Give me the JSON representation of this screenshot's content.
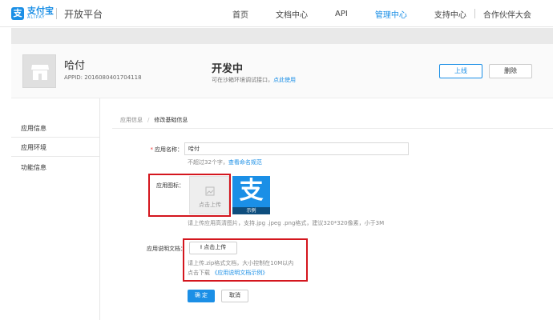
{
  "nav": {
    "logo_cn": "支付宝",
    "logo_en": "ALIPAY",
    "platform": "开放平台",
    "links": [
      "首页",
      "文档中心",
      "API",
      "管理中心",
      "支持中心",
      "合作伙伴大会"
    ],
    "active_index": 3
  },
  "app": {
    "name": "哈付",
    "appid": "APPID: 2016080401704118",
    "status_title": "开发中",
    "status_desc": "可在沙箱环境调试接口，",
    "status_link": "点此使用",
    "online_label": "上线",
    "delete_label": "删除"
  },
  "sidebar": {
    "items": [
      "应用信息",
      "应用环境",
      "功能信息"
    ]
  },
  "breadcrumb": {
    "parent": "应用信息",
    "current": "修改基础信息"
  },
  "form": {
    "name_label": "应用名称：",
    "name_value": "哈付",
    "name_hint": "不超过32个字，",
    "name_hint_link": "查看命名规范",
    "icon_label": "应用图标：",
    "upload_label": "点击上传",
    "sample_label": "示例",
    "icon_hint": "请上传应用高清图片，支持.jpg .jpeg .png格式，建议320*320像素，小于3M",
    "doc_label": "应用说明文档：",
    "file_upload_label": "点击上传",
    "doc_hint": "请上传.zip格式文档，大小控制在10M以内",
    "doc_download_prefix": "点击下载",
    "doc_download_link": "《应用说明文档示例》",
    "confirm_label": "确 定",
    "cancel_label": "取消"
  },
  "colors": {
    "accent": "#1b8fe6",
    "highlight_box": "#d4161e"
  }
}
